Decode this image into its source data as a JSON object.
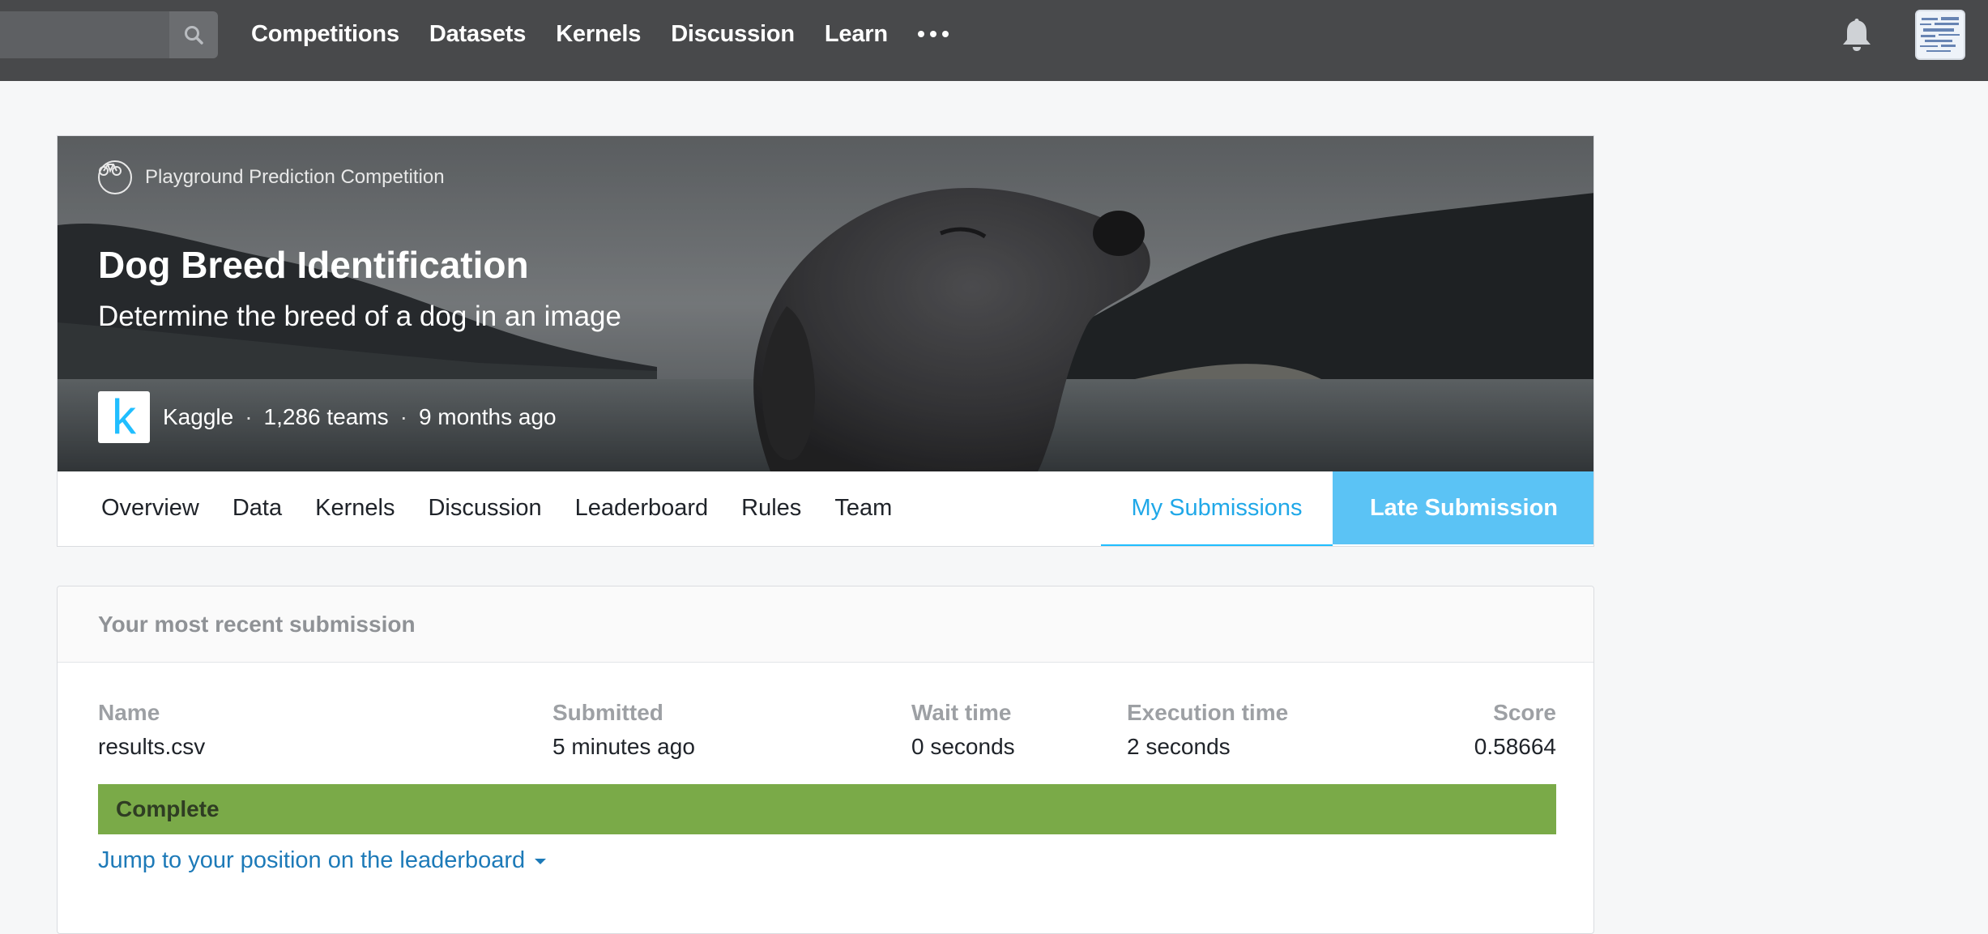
{
  "nav": {
    "links": [
      "Competitions",
      "Datasets",
      "Kernels",
      "Discussion",
      "Learn"
    ]
  },
  "competition": {
    "category": "Playground Prediction Competition",
    "title": "Dog Breed Identification",
    "subtitle": "Determine the breed of a dog in an image",
    "host_logo_letter": "k",
    "host": "Kaggle",
    "teams": "1,286 teams",
    "age": "9 months ago"
  },
  "tabs": {
    "items": [
      "Overview",
      "Data",
      "Kernels",
      "Discussion",
      "Leaderboard",
      "Rules",
      "Team"
    ],
    "my_submissions": "My Submissions",
    "late_submission": "Late Submission"
  },
  "submission": {
    "heading": "Your most recent submission",
    "name_label": "Name",
    "name_value": "results.csv",
    "submitted_label": "Submitted",
    "submitted_value": "5 minutes ago",
    "wait_label": "Wait time",
    "wait_value": "0 seconds",
    "exec_label": "Execution time",
    "exec_value": "2 seconds",
    "score_label": "Score",
    "score_value": "0.58664",
    "status": "Complete",
    "jump_link": "Jump to your position on the leaderboard"
  },
  "colors": {
    "nav_bg": "#48494b",
    "accent": "#20beff",
    "late_button": "#5bc3f5",
    "complete_green": "#7aaa48",
    "link": "#1d7ab8"
  }
}
